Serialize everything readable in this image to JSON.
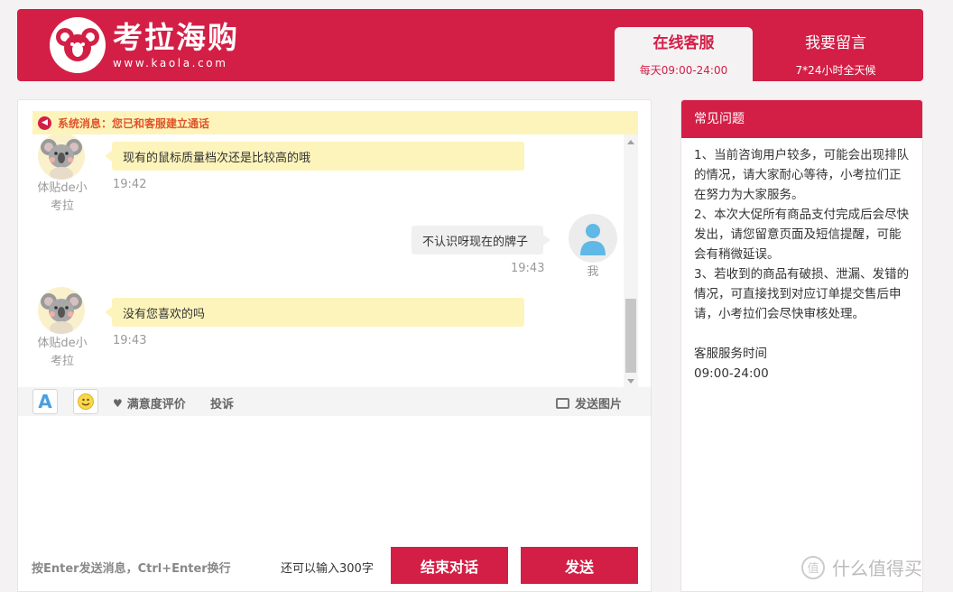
{
  "header": {
    "logo_name": "考拉海购",
    "logo_url": "www.kaola.com",
    "tabs": [
      {
        "title": "在线客服",
        "subtitle": "每天09:00-24:00",
        "active": true
      },
      {
        "title": "我要留言",
        "subtitle": "7*24小时全天候",
        "active": false
      }
    ],
    "brand_color": "#d31f46"
  },
  "chat": {
    "system_message": "系统消息：您已和客服建立通话",
    "messages": [
      {
        "sender": "体贴de小考拉",
        "side": "left",
        "text": "现有的鼠标质量档次还是比较高的哦",
        "time": "19:42"
      },
      {
        "sender": "我",
        "side": "right",
        "text": "不认识呀现在的牌子",
        "time": "19:43"
      },
      {
        "sender": "体贴de小考拉",
        "side": "left",
        "text": "没有您喜欢的吗",
        "time": "19:43"
      }
    ],
    "toolbar": {
      "font_label": "A",
      "rating_label": "满意度评价",
      "complaint_label": "投诉",
      "send_image_label": "发送图片"
    },
    "input_value": "",
    "hint": "按Enter发送消息，Ctrl+Enter换行",
    "remaining": "还可以输入300字",
    "end_button": "结束对话",
    "send_button": "发送"
  },
  "faq": {
    "title": "常见问题",
    "items": [
      "1、当前咨询用户较多，可能会出现排队的情况，请大家耐心等待，小考拉们正在努力为大家服务。",
      "2、本次大促所有商品支付完成后会尽快发出，请您留意页面及短信提醒，可能会有稍微延误。",
      "3、若收到的商品有破损、泄漏、发错的情况，可直接找到对应订单提交售后申请，小考拉们会尽快审核处理。"
    ],
    "service_time_title": "客服服务时间",
    "service_time": "09:00-24:00"
  },
  "watermark": "什么值得买"
}
